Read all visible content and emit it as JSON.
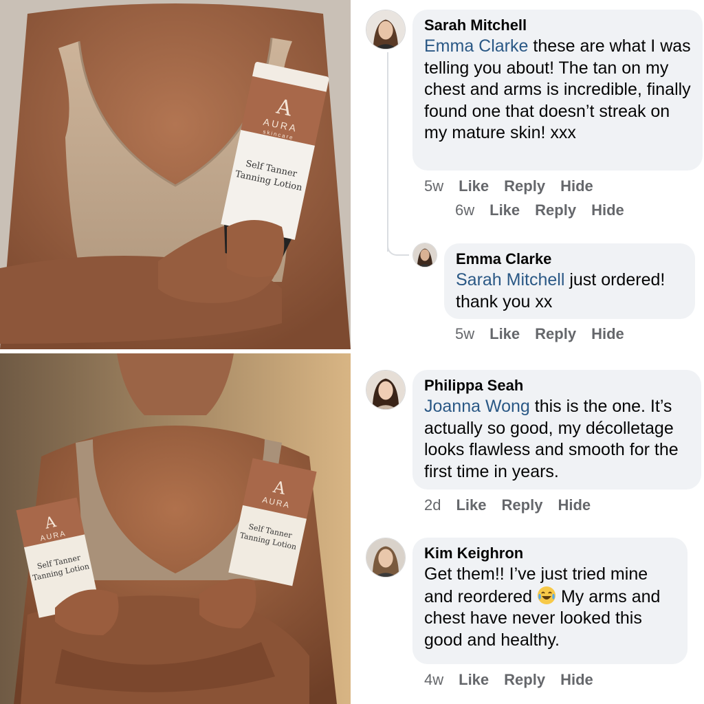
{
  "comments": [
    {
      "author": "Sarah Mitchell",
      "mention": "Emma Clarke",
      "text": " these are what I was telling you about! The tan on my chest and arms is incredible, finally found one that doesn’t streak on my mature skin! xxx",
      "time": "5w",
      "like": "Like",
      "reply": "Reply",
      "hide": "Hide",
      "extra_actions": {
        "time": "6w",
        "like": "Like",
        "reply": "Reply",
        "hide": "Hide"
      }
    },
    {
      "author": "Emma Clarke",
      "mention": "Sarah Mitchell",
      "text": " just ordered! thank you xx",
      "time": "5w",
      "like": "Like",
      "reply": "Reply",
      "hide": "Hide"
    },
    {
      "author": "Philippa Seah",
      "mention": "Joanna Wong",
      "text": " this is the one. It’s actually so good, my décolletage looks flawless and smooth for the first time in years.",
      "time": "2d",
      "like": "Like",
      "reply": "Reply",
      "hide": "Hide"
    },
    {
      "author": "Kim Keighron",
      "text_before_emoji": "Get them!! I’ve just tried mine and reordered ",
      "emoji": "laughing-crying-emoji",
      "text_after_emoji": " My arms and chest have never looked this good and healthy.",
      "time": "4w",
      "like": "Like",
      "reply": "Reply",
      "hide": "Hide"
    }
  ],
  "products": {
    "top_tube": {
      "brand_letter": "A",
      "brand": "AURA",
      "sub": "skincare",
      "name_line1": "Self Tanner",
      "name_line2": "Tanning Lotion"
    },
    "bottom_left_tube": {
      "brand_letter": "A",
      "brand": "AURA",
      "sub": "skincare",
      "name_line1": "Self Tanner",
      "name_line2": "Tanning Lotion"
    },
    "bottom_right_tube": {
      "brand_letter": "A",
      "brand": "AURA",
      "sub": "skincare",
      "name_line1": "Self Tanner",
      "name_line2": "Tanning Lotion"
    }
  },
  "colors": {
    "bubble": "#f0f2f5",
    "mention": "#2a5885",
    "meta": "#65676b",
    "tube_top": "#a8684a"
  }
}
